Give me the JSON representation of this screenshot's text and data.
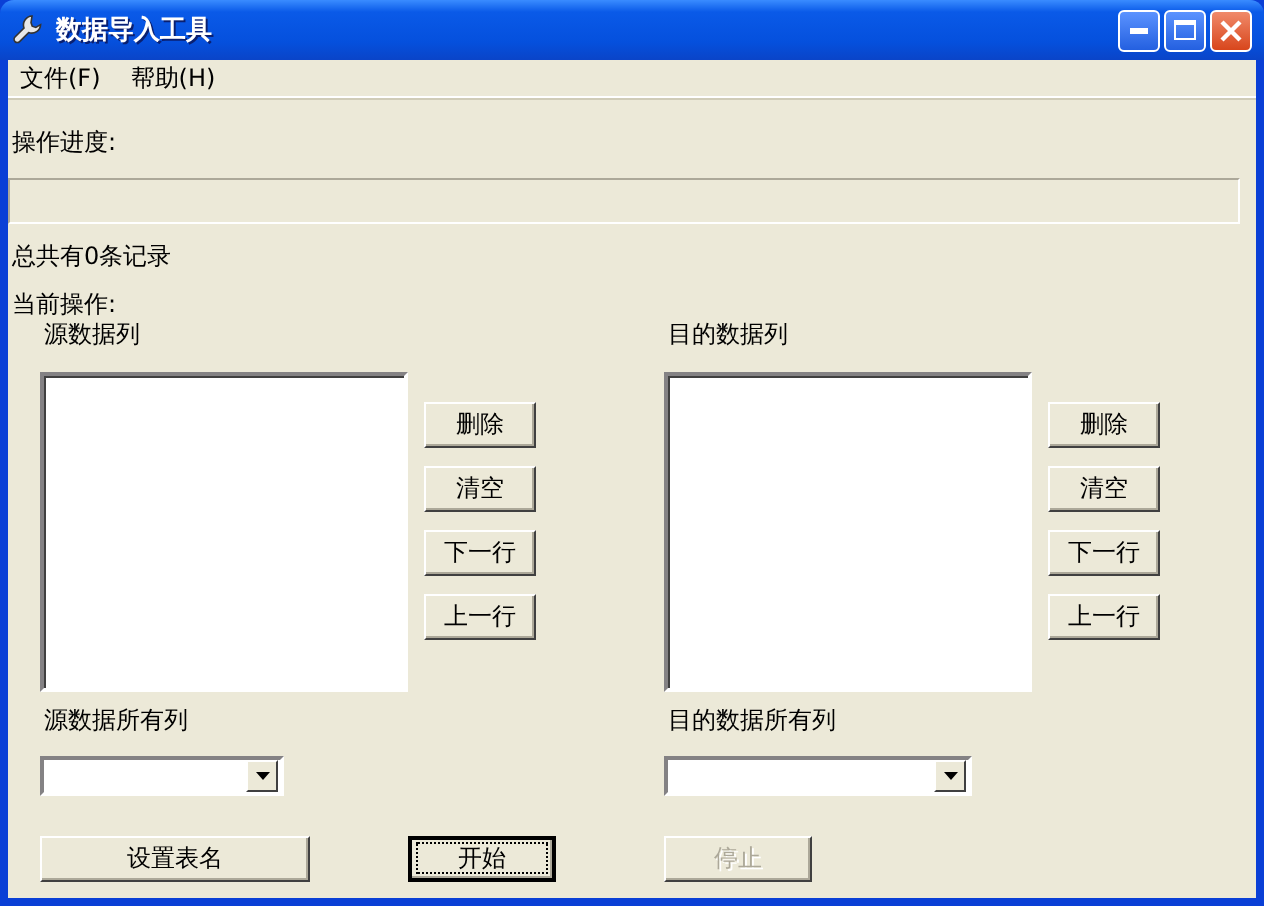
{
  "window": {
    "title": "数据导入工具"
  },
  "menu": [
    {
      "label": "文件(F)"
    },
    {
      "label": "帮助(H)"
    }
  ],
  "progress": {
    "label": "操作进度:",
    "level": 0
  },
  "record_count": "总共有0条记录",
  "current_operation": "当前操作:",
  "panels": [
    {
      "list_label": "源数据列",
      "buttons": [
        {
          "label": "删除"
        },
        {
          "label": "清空"
        },
        {
          "label": "下一行"
        },
        {
          "label": "上一行"
        }
      ],
      "columns_label": "源数据所有列"
    },
    {
      "list_label": "目的数据列",
      "buttons": [
        {
          "label": "删除"
        },
        {
          "label": "清空"
        },
        {
          "label": "下一行"
        },
        {
          "label": "上一行"
        }
      ],
      "columns_label": "目的数据所有列"
    }
  ],
  "actions": [
    {
      "label": "设置表名",
      "disabled": false,
      "focused": false
    },
    {
      "label": "开始",
      "disabled": false,
      "focused": true
    },
    {
      "label": "停止",
      "disabled": true,
      "focused": false
    }
  ]
}
